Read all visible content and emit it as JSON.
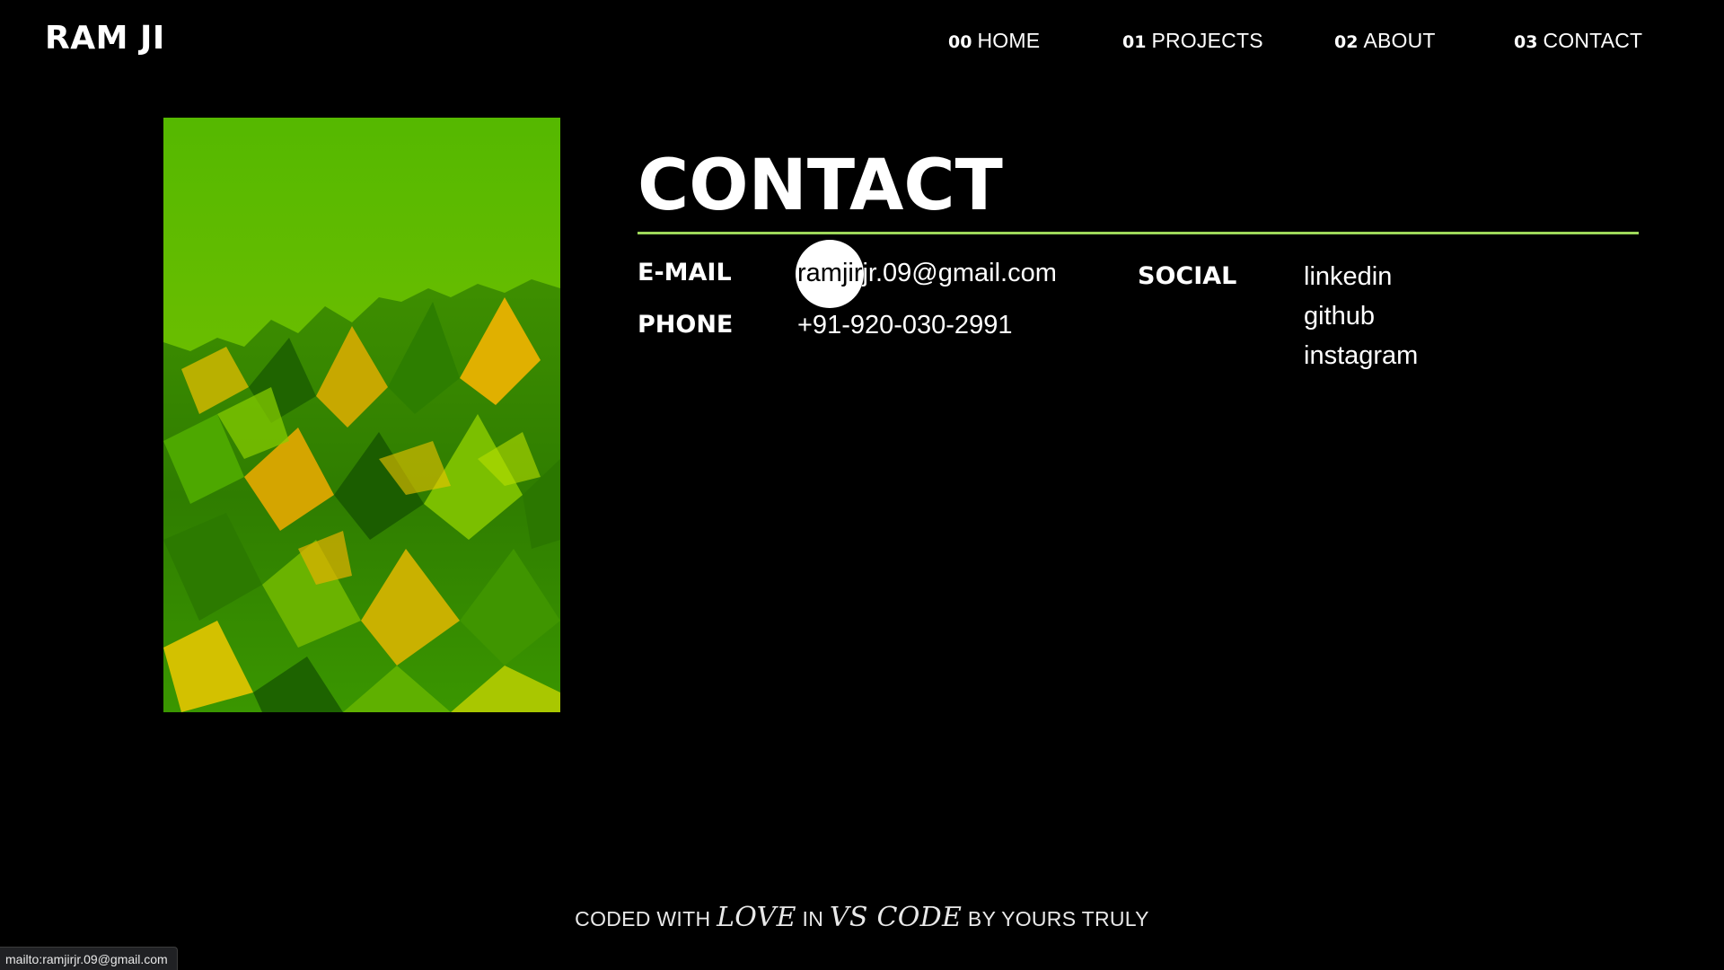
{
  "header": {
    "logo": "RAM JI",
    "nav": [
      {
        "num": "00",
        "label": "HOME"
      },
      {
        "num": "01",
        "label": "PROJECTS"
      },
      {
        "num": "02",
        "label": "ABOUT"
      },
      {
        "num": "03",
        "label": "CONTACT"
      }
    ]
  },
  "contact": {
    "title": "CONTACT",
    "email_label": "E-MAIL",
    "email_value": "ramjirjr.09@gmail.com",
    "phone_label": "PHONE",
    "phone_value": "+91-920-030-2991",
    "social_label": "SOCIAL",
    "social_links": [
      "linkedin",
      "github",
      "instagram"
    ]
  },
  "footer": {
    "part1": "CODED WITH",
    "love": "LOVE",
    "part2": "IN",
    "vscode": "VS CODE",
    "part3": "BY YOURS TRULY"
  },
  "status_bar": {
    "url": "mailto:ramjirjr.09@gmail.com"
  },
  "colors": {
    "background": "#000000",
    "accent": "#9ed85a",
    "text": "#ffffff"
  }
}
